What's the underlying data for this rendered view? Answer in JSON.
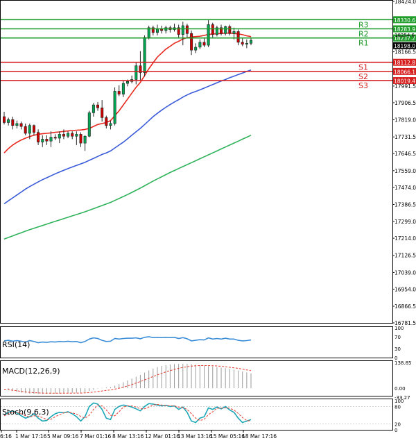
{
  "colors": {
    "background": "#ffffff",
    "frame": "#000000",
    "candle_up": "#00a651",
    "candle_down": "#cc0000",
    "ma_fast": "#e8281e",
    "ma_mid": "#3a5bd9",
    "ma_slow": "#2fb35a",
    "resistance": "#1f9c2a",
    "support": "#d61f1f",
    "resistance_label_bg": "#1f9c2a",
    "support_label_bg": "#d61f1f",
    "current_price_bg": "#000000",
    "rsi_line": "#3d8ed8",
    "macd_hist": "#9a9a9a",
    "macd_signal": "#e53b2e",
    "stoch_main": "#1aa6b7",
    "stoch_signal": "#e53b2e"
  },
  "main_panel": {
    "y_range": [
      16781.5,
      18424.0
    ],
    "y_ticks": [
      "18424.0",
      "18166.5",
      "17991.5",
      "17906.5",
      "17819.0",
      "17731.5",
      "17646.5",
      "17559.0",
      "17474.0",
      "17386.5",
      "17299.0",
      "17214.0",
      "17126.5",
      "17039.0",
      "16954.0",
      "16866.5",
      "16781.5"
    ],
    "levels": [
      {
        "name": "R3",
        "value": 18330.6,
        "label": "18330.6",
        "kind": "resistance"
      },
      {
        "name": "R2",
        "value": 18283.9,
        "label": "18283.9",
        "kind": "resistance"
      },
      {
        "name": "R1",
        "value": 18237.2,
        "label": "18237.2",
        "kind": "resistance"
      },
      {
        "name": "S1",
        "value": 18112.8,
        "label": "18112.8",
        "kind": "support"
      },
      {
        "name": "S2",
        "value": 18066.1,
        "label": "18066.1",
        "kind": "support"
      },
      {
        "name": "S3",
        "value": 18019.4,
        "label": "18019.4",
        "kind": "support"
      }
    ],
    "current_price": {
      "value": 18198.0,
      "label": "18198.0"
    },
    "extra_label": "18254.6"
  },
  "x_axis": {
    "labels": [
      "6:16",
      "1 Mar 17:16",
      "5 Mar 09:16",
      "7 Mar 01:16",
      "8 Mar 13:16",
      "12 Mar 01:16",
      "13 Mar 13:16",
      "15 Mar 05:16",
      "18 Mar 17:16"
    ]
  },
  "rsi_panel": {
    "title": "RSI(14)",
    "range": [
      0,
      100
    ],
    "ticks": [
      "100",
      "70",
      "30",
      "0"
    ]
  },
  "macd_panel": {
    "title": "MACD(12,26,9)",
    "ticks": [
      "138.85",
      "0.00",
      "-33.27"
    ]
  },
  "stoch_panel": {
    "title": "Stoch(9,6,3)",
    "range": [
      0,
      100
    ],
    "ticks": [
      "100",
      "80",
      "20",
      "0"
    ]
  },
  "chart_data": {
    "type": "candlestick",
    "x_labels": [
      "6:16",
      "1 Mar 17:16",
      "5 Mar 09:16",
      "7 Mar 01:16",
      "8 Mar 13:16",
      "12 Mar 01:16",
      "13 Mar 13:16",
      "15 Mar 05:16",
      "18 Mar 17:16"
    ],
    "ohlc": [
      {
        "o": 17835,
        "h": 17860,
        "l": 17795,
        "c": 17805
      },
      {
        "o": 17805,
        "h": 17830,
        "l": 17790,
        "c": 17820
      },
      {
        "o": 17820,
        "h": 17835,
        "l": 17770,
        "c": 17790
      },
      {
        "o": 17790,
        "h": 17815,
        "l": 17775,
        "c": 17800
      },
      {
        "o": 17800,
        "h": 17810,
        "l": 17770,
        "c": 17785
      },
      {
        "o": 17785,
        "h": 17800,
        "l": 17740,
        "c": 17750
      },
      {
        "o": 17750,
        "h": 17800,
        "l": 17720,
        "c": 17790
      },
      {
        "o": 17790,
        "h": 17795,
        "l": 17740,
        "c": 17755
      },
      {
        "o": 17755,
        "h": 17770,
        "l": 17690,
        "c": 17705
      },
      {
        "o": 17705,
        "h": 17740,
        "l": 17680,
        "c": 17720
      },
      {
        "o": 17720,
        "h": 17740,
        "l": 17690,
        "c": 17710
      },
      {
        "o": 17710,
        "h": 17760,
        "l": 17680,
        "c": 17730
      },
      {
        "o": 17730,
        "h": 17745,
        "l": 17715,
        "c": 17725
      },
      {
        "o": 17725,
        "h": 17760,
        "l": 17700,
        "c": 17745
      },
      {
        "o": 17745,
        "h": 17770,
        "l": 17720,
        "c": 17735
      },
      {
        "o": 17735,
        "h": 17760,
        "l": 17725,
        "c": 17750
      },
      {
        "o": 17750,
        "h": 17760,
        "l": 17720,
        "c": 17735
      },
      {
        "o": 17735,
        "h": 17760,
        "l": 17690,
        "c": 17745
      },
      {
        "o": 17745,
        "h": 17755,
        "l": 17680,
        "c": 17700
      },
      {
        "o": 17700,
        "h": 17740,
        "l": 17660,
        "c": 17735
      },
      {
        "o": 17735,
        "h": 17865,
        "l": 17730,
        "c": 17855
      },
      {
        "o": 17855,
        "h": 17905,
        "l": 17835,
        "c": 17895
      },
      {
        "o": 17895,
        "h": 17910,
        "l": 17865,
        "c": 17880
      },
      {
        "o": 17880,
        "h": 17920,
        "l": 17810,
        "c": 17830
      },
      {
        "o": 17830,
        "h": 17840,
        "l": 17775,
        "c": 17790
      },
      {
        "o": 17790,
        "h": 17815,
        "l": 17770,
        "c": 17800
      },
      {
        "o": 17800,
        "h": 17985,
        "l": 17790,
        "c": 17965
      },
      {
        "o": 17965,
        "h": 17995,
        "l": 17940,
        "c": 17950
      },
      {
        "o": 17950,
        "h": 18020,
        "l": 17935,
        "c": 18005
      },
      {
        "o": 18005,
        "h": 18025,
        "l": 17990,
        "c": 18015
      },
      {
        "o": 18015,
        "h": 18045,
        "l": 18005,
        "c": 18025
      },
      {
        "o": 18025,
        "h": 18110,
        "l": 18000,
        "c": 18095
      },
      {
        "o": 18095,
        "h": 18170,
        "l": 18020,
        "c": 18060
      },
      {
        "o": 18060,
        "h": 18250,
        "l": 18040,
        "c": 18240
      },
      {
        "o": 18240,
        "h": 18300,
        "l": 18230,
        "c": 18290
      },
      {
        "o": 18290,
        "h": 18300,
        "l": 18250,
        "c": 18265
      },
      {
        "o": 18265,
        "h": 18305,
        "l": 18250,
        "c": 18285
      },
      {
        "o": 18285,
        "h": 18300,
        "l": 18260,
        "c": 18275
      },
      {
        "o": 18275,
        "h": 18300,
        "l": 18260,
        "c": 18290
      },
      {
        "o": 18290,
        "h": 18300,
        "l": 18265,
        "c": 18280
      },
      {
        "o": 18280,
        "h": 18310,
        "l": 18270,
        "c": 18290
      },
      {
        "o": 18290,
        "h": 18305,
        "l": 18240,
        "c": 18255
      },
      {
        "o": 18255,
        "h": 18320,
        "l": 18200,
        "c": 18300
      },
      {
        "o": 18300,
        "h": 18310,
        "l": 18240,
        "c": 18260
      },
      {
        "o": 18260,
        "h": 18275,
        "l": 18150,
        "c": 18175
      },
      {
        "o": 18175,
        "h": 18210,
        "l": 18160,
        "c": 18190
      },
      {
        "o": 18190,
        "h": 18230,
        "l": 18180,
        "c": 18215
      },
      {
        "o": 18215,
        "h": 18240,
        "l": 18190,
        "c": 18200
      },
      {
        "o": 18200,
        "h": 18330,
        "l": 18190,
        "c": 18305
      },
      {
        "o": 18305,
        "h": 18315,
        "l": 18240,
        "c": 18255
      },
      {
        "o": 18255,
        "h": 18300,
        "l": 18245,
        "c": 18290
      },
      {
        "o": 18290,
        "h": 18305,
        "l": 18250,
        "c": 18260
      },
      {
        "o": 18260,
        "h": 18300,
        "l": 18250,
        "c": 18295
      },
      {
        "o": 18295,
        "h": 18305,
        "l": 18250,
        "c": 18260
      },
      {
        "o": 18260,
        "h": 18290,
        "l": 18230,
        "c": 18270
      },
      {
        "o": 18270,
        "h": 18280,
        "l": 18200,
        "c": 18215
      },
      {
        "o": 18215,
        "h": 18235,
        "l": 18195,
        "c": 18205
      },
      {
        "o": 18205,
        "h": 18230,
        "l": 18185,
        "c": 18210
      },
      {
        "o": 18210,
        "h": 18240,
        "l": 18200,
        "c": 18225
      }
    ],
    "ma_fast": [
      17650,
      17672,
      17690,
      17704,
      17716,
      17725,
      17733,
      17740,
      17745,
      17748,
      17750,
      17752,
      17755,
      17757,
      17760,
      17762,
      17764,
      17766,
      17767,
      17770,
      17775,
      17785,
      17795,
      17800,
      17805,
      17815,
      17840,
      17865,
      17895,
      17925,
      17955,
      17985,
      18010,
      18045,
      18080,
      18110,
      18140,
      18160,
      18180,
      18195,
      18210,
      18220,
      18232,
      18238,
      18242,
      18244,
      18246,
      18250,
      18255,
      18257,
      18259,
      18260,
      18262,
      18262,
      18260,
      18258,
      18254,
      18248,
      18244
    ],
    "ma_mid": [
      17390,
      17405,
      17420,
      17435,
      17450,
      17465,
      17478,
      17490,
      17502,
      17513,
      17523,
      17533,
      17543,
      17552,
      17561,
      17570,
      17578,
      17586,
      17594,
      17602,
      17612,
      17622,
      17632,
      17642,
      17650,
      17660,
      17675,
      17690,
      17705,
      17722,
      17740,
      17758,
      17775,
      17795,
      17815,
      17835,
      17852,
      17868,
      17883,
      17897,
      17910,
      17922,
      17935,
      17946,
      17956,
      17964,
      17972,
      17981,
      17990,
      17999,
      18008,
      18017,
      18025,
      18034,
      18042,
      18050,
      18058,
      18066,
      18074
    ],
    "ma_slow": [
      17210,
      17218,
      17226,
      17234,
      17242,
      17250,
      17258,
      17265,
      17272,
      17279,
      17286,
      17293,
      17300,
      17307,
      17314,
      17321,
      17328,
      17335,
      17342,
      17349,
      17357,
      17365,
      17373,
      17381,
      17389,
      17397,
      17407,
      17417,
      17427,
      17437,
      17448,
      17459,
      17470,
      17482,
      17494,
      17506,
      17517,
      17528,
      17539,
      17550,
      17560,
      17570,
      17580,
      17590,
      17600,
      17610,
      17620,
      17630,
      17640,
      17650,
      17660,
      17670,
      17680,
      17690,
      17700,
      17710,
      17720,
      17730,
      17740
    ],
    "rsi": [
      56,
      58,
      55,
      57,
      55,
      52,
      57,
      54,
      50,
      52,
      51,
      53,
      52,
      54,
      53,
      55,
      53,
      54,
      50,
      54,
      62,
      66,
      64,
      58,
      54,
      55,
      64,
      62,
      64,
      65,
      65,
      66,
      63,
      68,
      70,
      67,
      68,
      67,
      68,
      67,
      68,
      64,
      67,
      63,
      56,
      58,
      60,
      59,
      66,
      62,
      64,
      62,
      65,
      62,
      62,
      58,
      56,
      57,
      59
    ],
    "macd_hist": [
      0,
      -8,
      -15,
      -20,
      -24,
      -27,
      -29,
      -30,
      -31,
      -31,
      -30,
      -30,
      -29,
      -28,
      -27,
      -26,
      -25,
      -24,
      -24,
      -22,
      -15,
      -8,
      -2,
      2,
      4,
      6,
      14,
      22,
      32,
      42,
      52,
      62,
      72,
      84,
      96,
      106,
      114,
      120,
      125,
      128,
      130,
      131,
      132,
      132,
      130,
      127,
      124,
      121,
      119,
      117,
      114,
      111,
      108,
      104,
      100,
      95,
      90,
      85,
      80
    ],
    "macd_signal": [
      -5,
      -8,
      -11,
      -14,
      -17,
      -20,
      -22,
      -24,
      -25,
      -26,
      -27,
      -27,
      -27,
      -27,
      -27,
      -27,
      -26,
      -26,
      -26,
      -25,
      -23,
      -21,
      -18,
      -15,
      -12,
      -9,
      -5,
      0,
      6,
      12,
      20,
      28,
      36,
      45,
      54,
      63,
      72,
      80,
      88,
      95,
      101,
      107,
      112,
      116,
      119,
      121,
      122,
      122,
      122,
      121,
      120,
      118,
      116,
      113,
      110,
      107,
      103,
      99,
      95
    ],
    "stoch_k": [
      50,
      60,
      65,
      58,
      48,
      40,
      45,
      55,
      40,
      30,
      32,
      45,
      55,
      60,
      58,
      62,
      55,
      45,
      30,
      45,
      80,
      92,
      88,
      70,
      40,
      35,
      70,
      80,
      85,
      82,
      78,
      72,
      65,
      80,
      90,
      88,
      85,
      82,
      84,
      80,
      82,
      70,
      78,
      60,
      30,
      25,
      40,
      45,
      75,
      70,
      78,
      72,
      80,
      68,
      60,
      40,
      25,
      30,
      35
    ],
    "stoch_d": [
      48,
      55,
      60,
      60,
      55,
      48,
      44,
      48,
      47,
      42,
      35,
      36,
      45,
      52,
      58,
      60,
      58,
      54,
      46,
      40,
      50,
      70,
      85,
      82,
      68,
      50,
      48,
      62,
      78,
      82,
      82,
      78,
      72,
      72,
      78,
      85,
      87,
      85,
      84,
      82,
      82,
      78,
      76,
      70,
      55,
      40,
      32,
      36,
      52,
      62,
      74,
      74,
      76,
      74,
      68,
      56,
      42,
      32,
      30
    ]
  }
}
